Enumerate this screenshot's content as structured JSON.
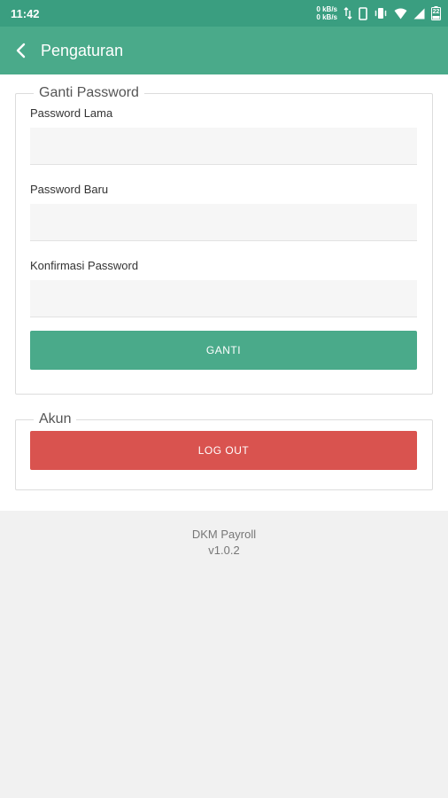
{
  "status_bar": {
    "time": "11:42",
    "net_up": "0 kB/s",
    "net_down": "0 kB/s",
    "battery_level": "22"
  },
  "app_bar": {
    "title": "Pengaturan",
    "back_icon": "chevron-left-icon"
  },
  "password_section": {
    "legend": "Ganti Password",
    "old_password_label": "Password Lama",
    "old_password_value": "",
    "new_password_label": "Password Baru",
    "new_password_value": "",
    "confirm_password_label": "Konfirmasi Password",
    "confirm_password_value": "",
    "submit_label": "GANTI"
  },
  "account_section": {
    "legend": "Akun",
    "logout_label": "LOG OUT"
  },
  "footer": {
    "app_name": "DKM Payroll",
    "version": "v1.0.2"
  },
  "colors": {
    "status_bar": "#3a9e80",
    "primary": "#4aaa8a",
    "danger": "#d9534f",
    "background": "#f1f1f1"
  }
}
